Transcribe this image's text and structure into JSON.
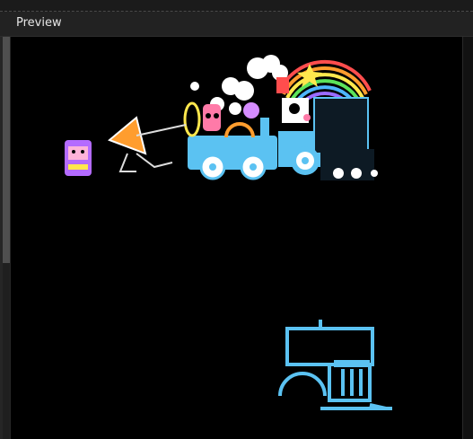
{
  "panel": {
    "title": "Preview"
  },
  "colors": {
    "accent_blue": "#5bc2f2",
    "rainbow": [
      "#ff4d4d",
      "#ff9d2e",
      "#ffe84d",
      "#5be35b",
      "#4db6ff",
      "#9b6bff"
    ],
    "stage_bg": "#000000"
  },
  "icons": {
    "sprite_main": "train-parade-sprite",
    "sprite_secondary": "train-outline-sprite"
  }
}
